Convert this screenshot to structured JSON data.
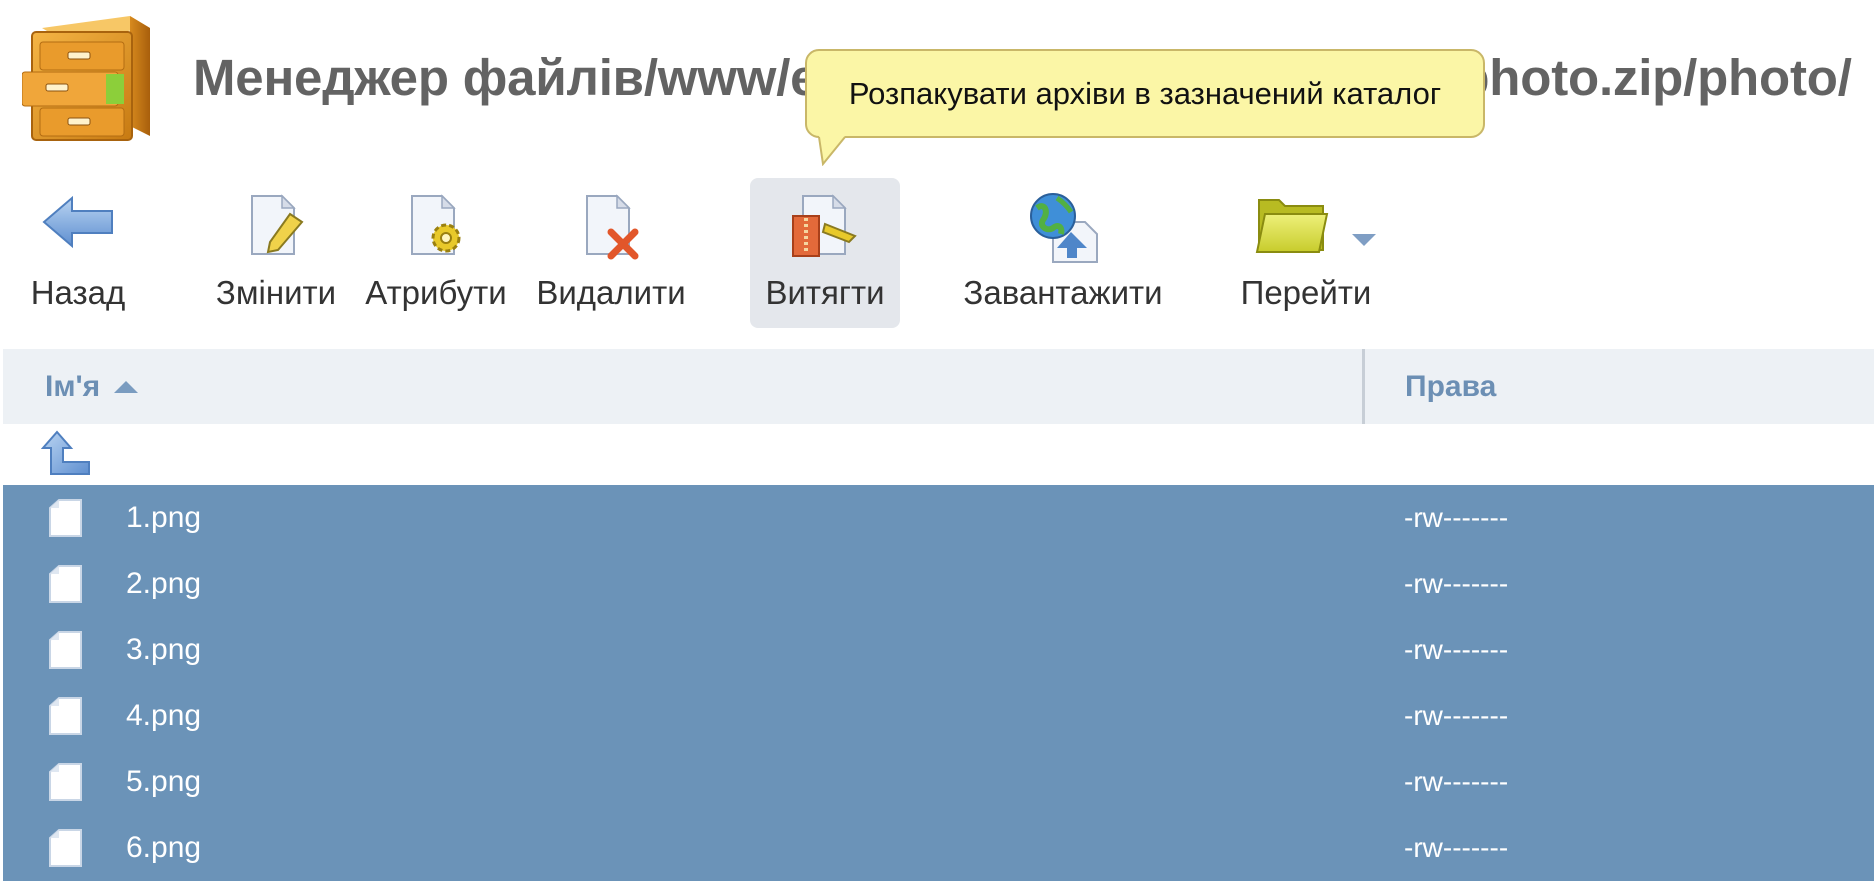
{
  "header": {
    "title_prefix": "Менеджер файлів/www/e",
    "title_suffix": "photo.zip/photo/",
    "app_icon": "file-cabinet-icon"
  },
  "tooltip": {
    "text": "Розпакувати архіви в зазначений каталог"
  },
  "toolbar": {
    "back": {
      "label": "Назад",
      "icon": "back-arrow-icon"
    },
    "edit": {
      "label": "Змінити",
      "icon": "edit-file-icon"
    },
    "attributes": {
      "label": "Атрибути",
      "icon": "attributes-gear-icon"
    },
    "delete": {
      "label": "Видалити",
      "icon": "delete-file-icon"
    },
    "extract": {
      "label": "Витягти",
      "icon": "extract-archive-icon",
      "active": true
    },
    "upload": {
      "label": "Завантажити",
      "icon": "upload-globe-icon"
    },
    "goto": {
      "label": "Перейти",
      "icon": "folder-icon",
      "has_dropdown": true
    }
  },
  "table": {
    "columns": {
      "name": "Ім'я",
      "permissions": "Права"
    },
    "sort": {
      "column": "name",
      "direction": "asc"
    },
    "rows": [
      {
        "name": "1.png",
        "permissions": "-rw-------",
        "selected": true
      },
      {
        "name": "2.png",
        "permissions": "-rw-------",
        "selected": true
      },
      {
        "name": "3.png",
        "permissions": "-rw-------",
        "selected": true
      },
      {
        "name": "4.png",
        "permissions": "-rw-------",
        "selected": true
      },
      {
        "name": "5.png",
        "permissions": "-rw-------",
        "selected": true
      },
      {
        "name": "6.png",
        "permissions": "-rw-------",
        "selected": true
      }
    ]
  },
  "colors": {
    "selected_row": "#6b93b8",
    "header_bg": "#edf1f5",
    "header_text": "#6c8fb4",
    "tooltip_bg": "#fbf6a6",
    "active_button_bg": "#e4e7ec"
  }
}
